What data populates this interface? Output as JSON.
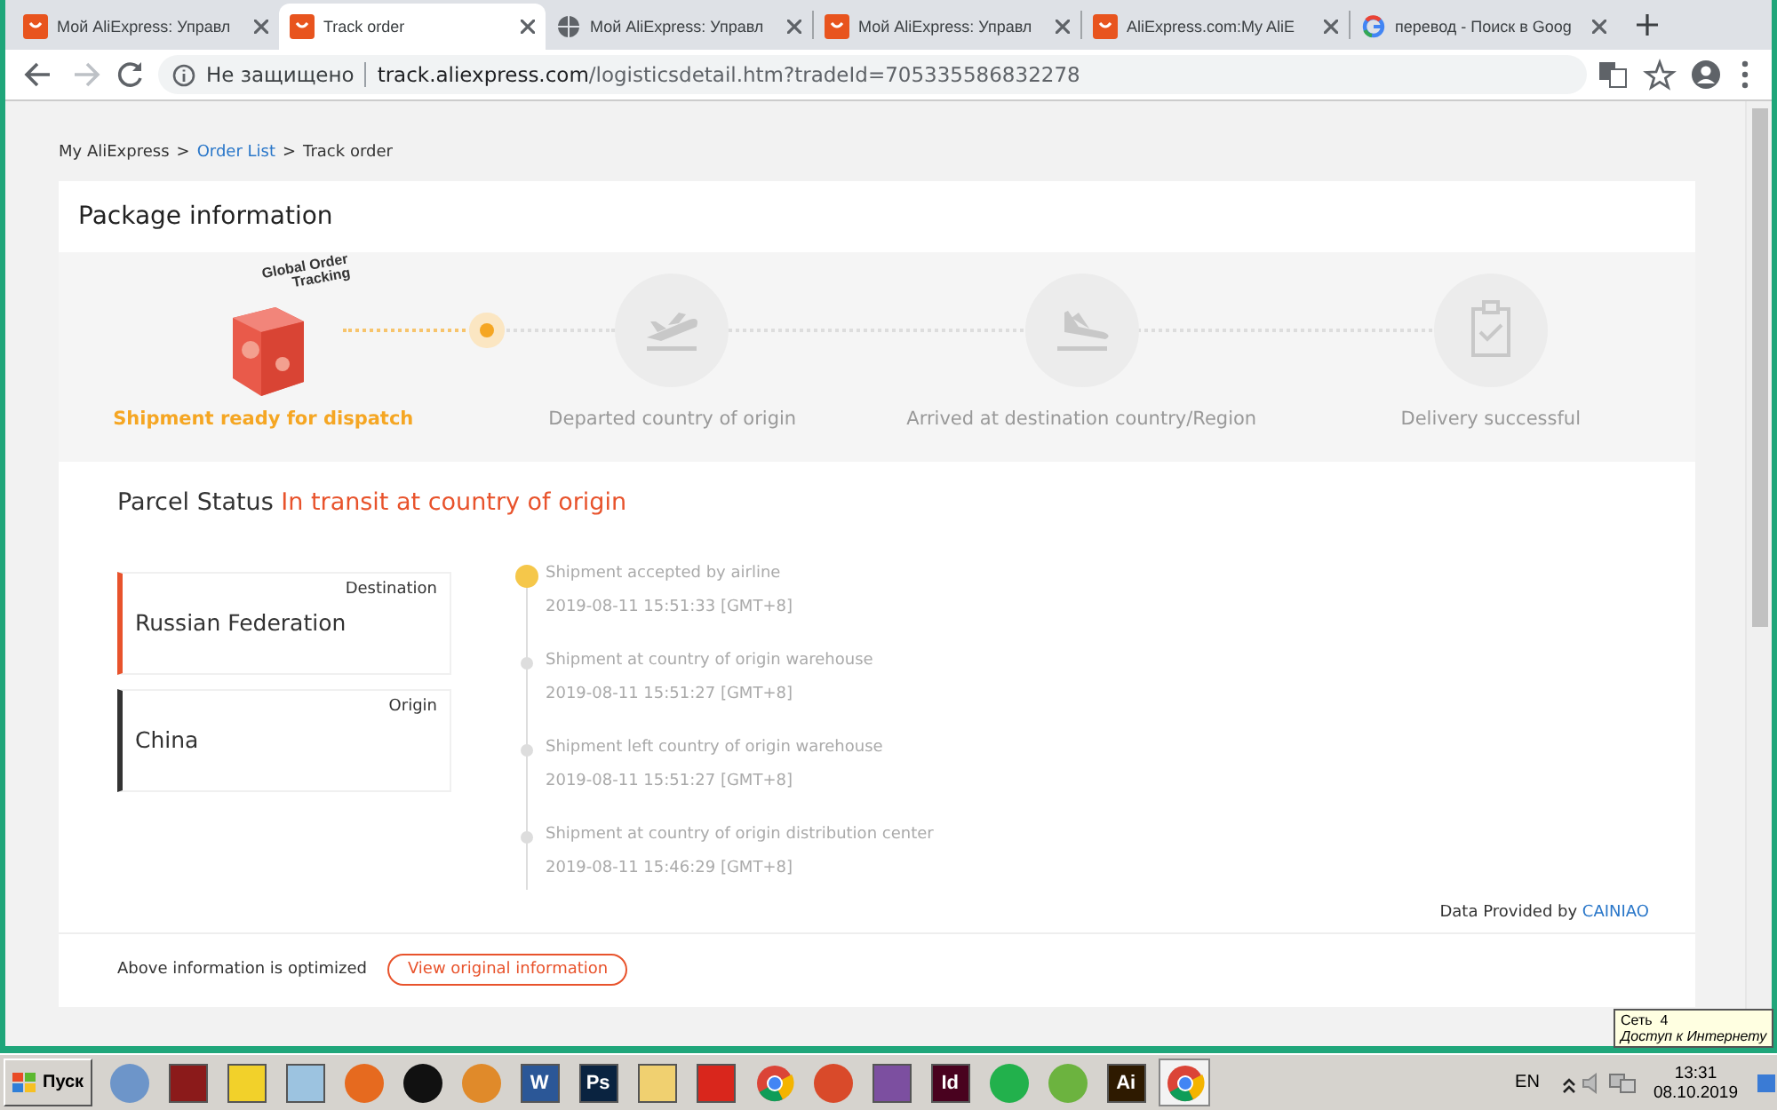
{
  "browser": {
    "tabs": [
      {
        "title": "Мой AliExpress: Управл",
        "kind": "aliexpress",
        "selected": false
      },
      {
        "title": "Track order",
        "kind": "aliexpress",
        "selected": true
      },
      {
        "title": "Мой AliExpress: Управл",
        "kind": "globe",
        "selected": false
      },
      {
        "title": "Мой AliExpress: Управл",
        "kind": "aliexpress",
        "selected": false
      },
      {
        "title": "AliExpress.com:My AliE",
        "kind": "aliexpress",
        "selected": false
      },
      {
        "title": "перевод - Поиск в Goog",
        "kind": "google",
        "selected": false
      }
    ],
    "address": {
      "security": "Не защищено",
      "host": "track.aliexpress.com",
      "path": "/logisticsdetail.htm?tradeId=705335586832278"
    }
  },
  "breadcrumb": {
    "separator": ">",
    "items": [
      {
        "label": "My AliExpress",
        "link": false
      },
      {
        "label": "Order List",
        "link": true
      },
      {
        "label": "Track order",
        "link": false
      }
    ]
  },
  "package": {
    "title": "Package information",
    "steps": [
      {
        "label": "Shipment ready for dispatch",
        "kind": "box",
        "active": true,
        "badge": "Global Order Tracking"
      },
      {
        "label": "Departed country of origin",
        "kind": "takeoff",
        "active": false
      },
      {
        "label": "Arrived at destination country/Region",
        "kind": "landing",
        "active": false
      },
      {
        "label": "Delivery successful",
        "kind": "clipboard",
        "active": false
      }
    ]
  },
  "parcel_status": {
    "label": "Parcel Status",
    "value": "In transit at country of origin"
  },
  "locations": [
    {
      "role": "Destination",
      "place": "Russian Federation",
      "color": "#e8532c"
    },
    {
      "role": "Origin",
      "place": "China",
      "color": "#333333"
    }
  ],
  "events": [
    {
      "text": "Shipment accepted by airline",
      "time": "2019-08-11 15:51:33 [GMT+8]",
      "current": true
    },
    {
      "text": "Shipment at country of origin warehouse",
      "time": "2019-08-11 15:51:27 [GMT+8]",
      "current": false
    },
    {
      "text": "Shipment left country of origin warehouse",
      "time": "2019-08-11 15:51:27 [GMT+8]",
      "current": false
    },
    {
      "text": "Shipment at country of origin distribution center",
      "time": "2019-08-11 15:46:29 [GMT+8]",
      "current": false
    }
  ],
  "provider": {
    "label": "Data Provided by",
    "name": "CAINIAO"
  },
  "footer": {
    "note": "Above information is optimized",
    "button": "View original information"
  },
  "taskbar": {
    "start": "Пуск",
    "apps": [
      {
        "kind": "round",
        "color": "#6d95c9",
        "selected": false
      },
      {
        "kind": "tile",
        "color": "#8b1a1a",
        "selected": false
      },
      {
        "kind": "tile",
        "color": "#f2d12a",
        "selected": false
      },
      {
        "kind": "tile",
        "color": "#9cc3e0",
        "selected": false
      },
      {
        "kind": "round",
        "color": "#e66a1f",
        "selected": false
      },
      {
        "kind": "round",
        "color": "#111111",
        "selected": false
      },
      {
        "kind": "round",
        "color": "#e08a2a",
        "selected": false
      },
      {
        "kind": "tile",
        "color": "#2b5797",
        "label": "W",
        "selected": false
      },
      {
        "kind": "tile",
        "color": "#0a2340",
        "label": "Ps",
        "selected": false
      },
      {
        "kind": "tile",
        "color": "#f0d070",
        "selected": false
      },
      {
        "kind": "tile",
        "color": "#d9261c",
        "selected": false
      },
      {
        "kind": "chrome",
        "selected": false
      },
      {
        "kind": "round",
        "color": "#d94a2a",
        "selected": false
      },
      {
        "kind": "tile",
        "color": "#7c4fa0",
        "selected": false
      },
      {
        "kind": "tile",
        "color": "#49021f",
        "label": "Id",
        "selected": false
      },
      {
        "kind": "round",
        "color": "#22b14c",
        "selected": false
      },
      {
        "kind": "round",
        "color": "#6cb33f",
        "selected": false
      },
      {
        "kind": "tile",
        "color": "#2e1a00",
        "label": "Ai",
        "selected": false
      },
      {
        "kind": "chrome",
        "selected": true
      }
    ],
    "lang": "EN",
    "time": "13:31",
    "date": "08.10.2019"
  },
  "tooltip": {
    "title": "Сеть  4",
    "text": "Доступ к Интернету"
  }
}
